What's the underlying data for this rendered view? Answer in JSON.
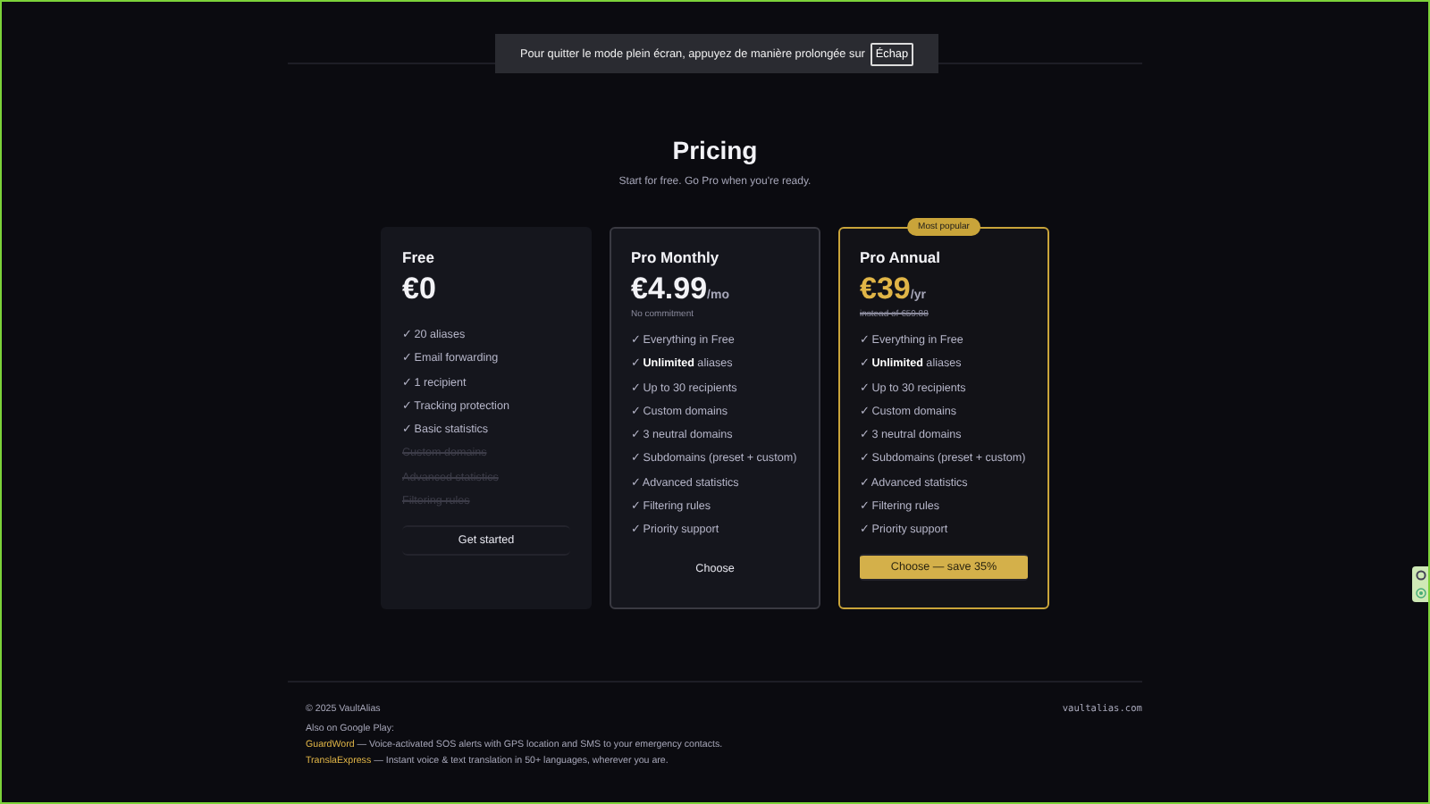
{
  "notice": {
    "text": "Pour quitter le mode plein écran, appuyez de manière prolongée sur",
    "key": "Échap"
  },
  "header": {
    "title": "Pricing",
    "subtitle": "Start for free. Go Pro when you're ready."
  },
  "plans": [
    {
      "kind": "basic",
      "name": "Free",
      "price": "€0",
      "features": [
        {
          "text": "✓ 20 aliases",
          "included": true
        },
        {
          "text": "✓ Email forwarding",
          "included": true
        },
        {
          "text": "✓ 1 recipient",
          "included": true
        },
        {
          "text": "✓ Tracking protection",
          "included": true
        },
        {
          "text": "✓ Basic statistics",
          "included": true
        },
        {
          "text": "Custom domains",
          "included": false
        },
        {
          "text": "Advanced statistics",
          "included": false
        },
        {
          "text": "Filtering rules",
          "included": false
        }
      ],
      "button": "Get started"
    },
    {
      "kind": "standard",
      "name": "Pro Monthly",
      "price": "€4.99",
      "period": "/mo",
      "note": "No commitment",
      "features": [
        {
          "text": "✓ Everything in Free",
          "included": true
        },
        {
          "text": "✓ **Unlimited** aliases",
          "included": true
        },
        {
          "text": "✓ Up to 30 recipients",
          "included": true
        },
        {
          "text": "✓ Custom domains",
          "included": true
        },
        {
          "text": "✓ 3 neutral domains",
          "included": true
        },
        {
          "text": "✓ Subdomains (preset + custom)",
          "included": true
        },
        {
          "text": "✓ Advanced statistics",
          "included": true
        },
        {
          "text": "✓ Filtering rules",
          "included": true
        },
        {
          "text": "✓ Priority support",
          "included": true
        }
      ],
      "button": "Choose"
    },
    {
      "kind": "featured",
      "badge": "Most popular",
      "name": "Pro Annual",
      "price": "€39",
      "period": "/yr",
      "old_price": "instead of €59.88",
      "features": [
        {
          "text": "✓ Everything in Free",
          "included": true
        },
        {
          "text": "✓ **Unlimited** aliases",
          "included": true
        },
        {
          "text": "✓ Up to 30 recipients",
          "included": true
        },
        {
          "text": "✓ Custom domains",
          "included": true
        },
        {
          "text": "✓ 3 neutral domains",
          "included": true
        },
        {
          "text": "✓ Subdomains (preset + custom)",
          "included": true
        },
        {
          "text": "✓ Advanced statistics",
          "included": true
        },
        {
          "text": "✓ Filtering rules",
          "included": true
        },
        {
          "text": "✓ Priority support",
          "included": true
        }
      ],
      "button": "Choose — save 35%"
    }
  ],
  "footer": {
    "copyright": "© 2025 VaultAlias",
    "domain": "vaultalias.com",
    "also": "Also on Google Play:",
    "apps": [
      {
        "name": "GuardWord",
        "description": "— Voice-activated SOS alerts with GPS location and SMS to your emergency contacts."
      },
      {
        "name": "TranslaExpress",
        "description": "— Instant voice & text translation in 50+ languages, wherever you are."
      }
    ]
  }
}
